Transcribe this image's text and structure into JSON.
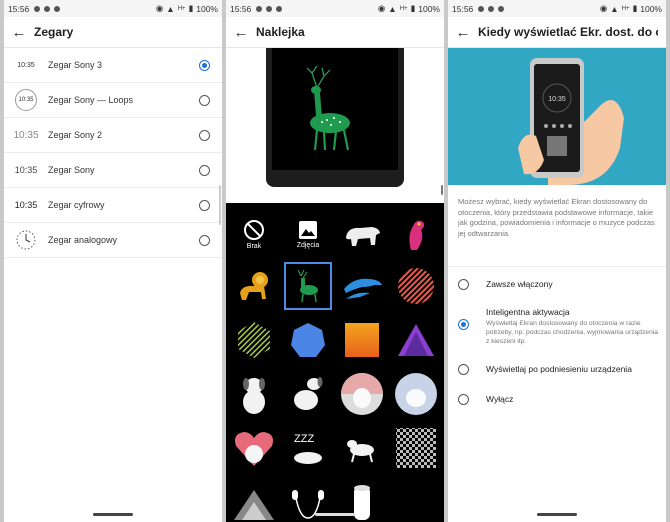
{
  "status": {
    "time": "15:56",
    "battery": "100%",
    "network": "H+"
  },
  "panel1": {
    "title": "Zegary",
    "items": [
      {
        "thumb": "10:35",
        "label": "Zegar Sony 3",
        "selected": true
      },
      {
        "thumb": "10:35",
        "label": "Zegar Sony — Loops",
        "selected": false
      },
      {
        "thumb": "10:35",
        "label": "Zegar Sony 2",
        "selected": false
      },
      {
        "thumb": "10:35",
        "label": "Zegar Sony",
        "selected": false
      },
      {
        "thumb": "10:35",
        "label": "Zegar cyfrowy",
        "selected": false
      },
      {
        "thumb": "",
        "label": "Zegar analogowy",
        "selected": false
      }
    ]
  },
  "panel2": {
    "title": "Naklejka",
    "cells": [
      {
        "name": "none-icon",
        "label": "Brak"
      },
      {
        "name": "photos-icon",
        "label": "Zdjęcia"
      }
    ]
  },
  "panel3": {
    "title": "Kiedy wyświetlać Ekr. dost. do oto...",
    "phone_time": "10:35",
    "description": "Możesz wybrać, kiedy wyświetlać Ekran dostosowany do otoczenia, który przedstawia podstawowe informacje, takie jak godzina, powiadomienia i informacje o muzyce podczas jej odtwarzania.",
    "options": [
      {
        "title": "Zawsze włączony",
        "sub": "",
        "selected": false
      },
      {
        "title": "Inteligentna aktywacja",
        "sub": "Wyświetlaj Ekran dostosowany do otoczenia w razie potrzeby, np. podczas chodzenia, wyjmowania urządzenia z kieszeni itp.",
        "selected": true
      },
      {
        "title": "Wyświetlaj po podniesieniu urządzenia",
        "sub": "",
        "selected": false
      },
      {
        "title": "Wyłącz",
        "sub": "",
        "selected": false
      }
    ]
  }
}
